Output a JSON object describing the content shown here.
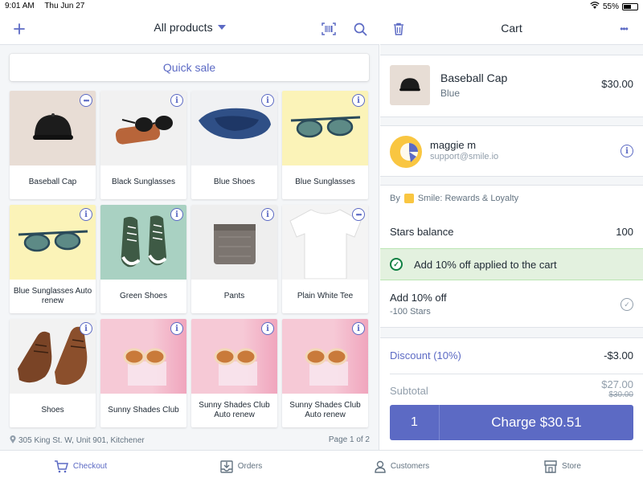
{
  "status": {
    "time": "9:01 AM",
    "date": "Thu Jun 27",
    "battery": "55%",
    "battery_level": 0.55
  },
  "catalog": {
    "filter_label": "All products",
    "quick_sale": "Quick sale",
    "address": "305 King St. W, Unit 901, Kitchener",
    "page_label": "Page 1 of 2",
    "products": [
      {
        "name": "Baseball Cap",
        "badge": "more"
      },
      {
        "name": "Black Sunglasses",
        "badge": "info"
      },
      {
        "name": "Blue Shoes",
        "badge": "info"
      },
      {
        "name": "Blue Sunglasses",
        "badge": "info"
      },
      {
        "name": "Blue Sunglasses Auto renew",
        "badge": "info"
      },
      {
        "name": "Green Shoes",
        "badge": "info"
      },
      {
        "name": "Pants",
        "badge": "info"
      },
      {
        "name": "Plain White Tee",
        "badge": "more"
      },
      {
        "name": "Shoes",
        "badge": "info"
      },
      {
        "name": "Sunny Shades Club",
        "badge": "info"
      },
      {
        "name": "Sunny Shades Club Auto renew",
        "badge": "info"
      },
      {
        "name": "Sunny Shades Club Auto renew",
        "badge": "info"
      }
    ]
  },
  "cart": {
    "title": "Cart",
    "line_item": {
      "title": "Baseball Cap",
      "variant": "Blue",
      "price": "$30.00"
    },
    "customer": {
      "name": "maggie m",
      "email": "support@smile.io"
    },
    "app": {
      "by_label": "By",
      "app_name": "Smile: Rewards & Loyalty",
      "stars_label": "Stars balance",
      "stars_value": "100",
      "applied_banner": "Add 10% off applied to the cart",
      "reward_title": "Add 10% off",
      "reward_cost": "-100 Stars"
    },
    "discount_label": "Discount (10%)",
    "discount_value": "-$3.00",
    "subtotal_label": "Subtotal",
    "subtotal_value": "$27.00",
    "subtotal_original": "$30.00",
    "quantity": "1",
    "charge_label": "Charge $30.51"
  },
  "tabs": [
    {
      "label": "Checkout",
      "icon": "cart-icon",
      "active": true
    },
    {
      "label": "Orders",
      "icon": "orders-icon",
      "active": false
    },
    {
      "label": "Customers",
      "icon": "person-icon",
      "active": false
    },
    {
      "label": "Store",
      "icon": "store-icon",
      "active": false
    }
  ],
  "colors": {
    "accent": "#5c6ac4",
    "success_bg": "#e3f1df",
    "success": "#108043"
  }
}
